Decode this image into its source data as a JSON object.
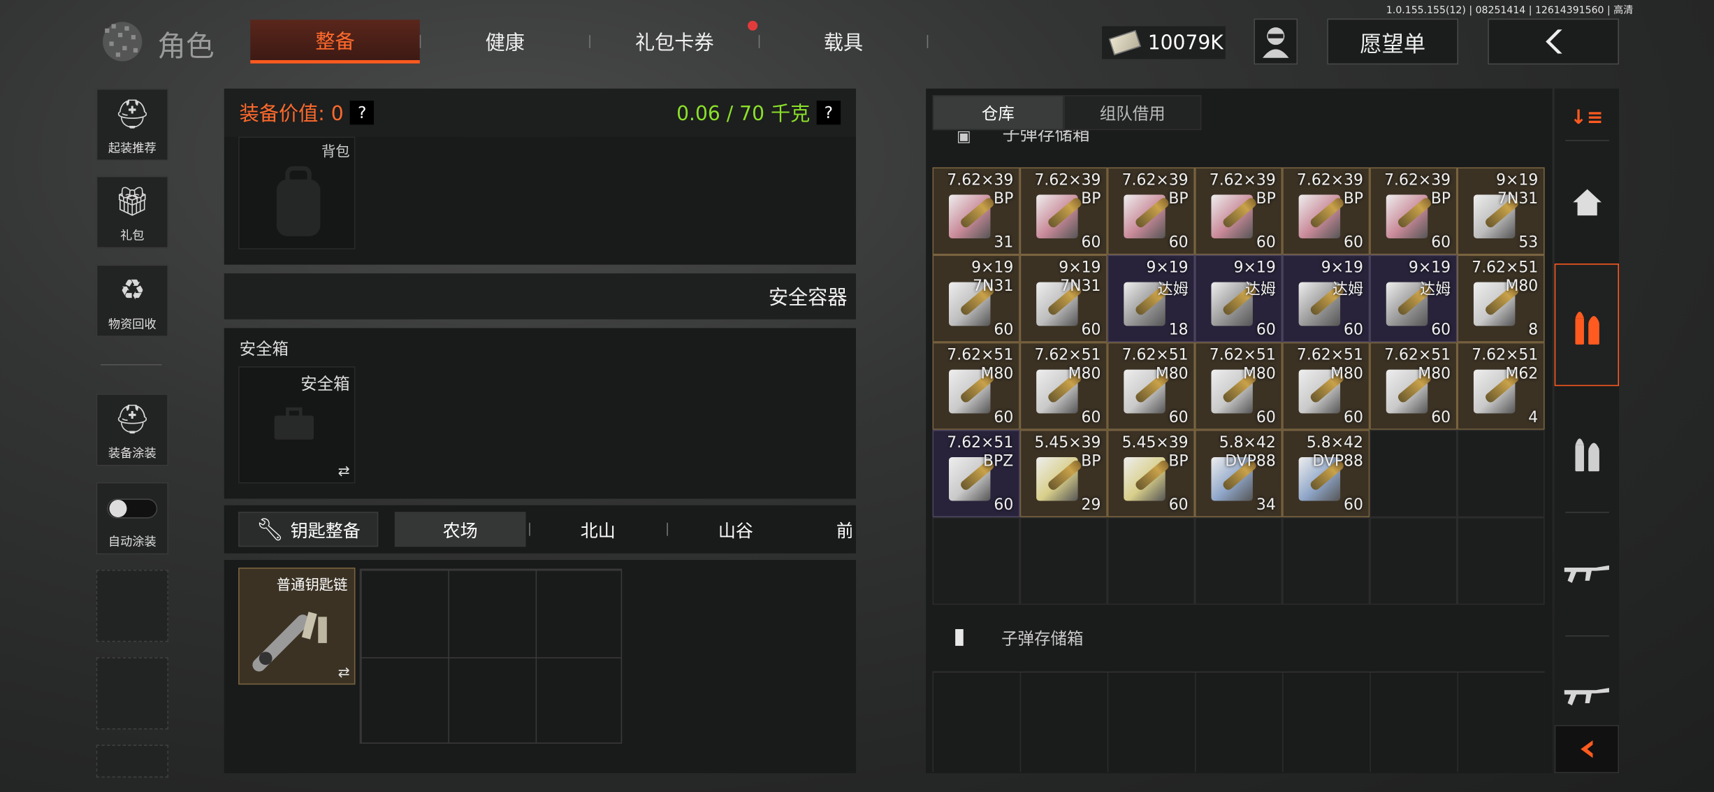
{
  "version": "1.0.155.155(12) | 08251414 | 12614391560 | 高清",
  "header": {
    "title": "角色",
    "tabs": [
      {
        "label": "整备",
        "active": true
      },
      {
        "label": "健康"
      },
      {
        "label": "礼包卡券",
        "badge": true
      },
      {
        "label": "载具"
      }
    ],
    "money": "10079K",
    "wishlist": "愿望单"
  },
  "sidebar": {
    "items": [
      {
        "label": "起装推荐",
        "icon": "helmet-icon"
      },
      {
        "label": "礼包",
        "icon": "gift-icon"
      },
      {
        "label": "物资回收",
        "icon": "recycle-icon"
      },
      {
        "label": "装备涂装",
        "icon": "paint-icon"
      },
      {
        "label": "自动涂装",
        "icon": "toggle-icon"
      }
    ]
  },
  "equipment": {
    "value_label": "装备价值: 0",
    "weight": "0.06 / 70 千克",
    "backpack_label": "背包",
    "secure_header": "安全容器",
    "secure_box_label": "安全箱",
    "secure_slot_label": "安全箱",
    "swap_icon": "⇄"
  },
  "keys": {
    "button": "钥匙整备",
    "tabs": [
      "农场",
      "北山",
      "山谷",
      "前"
    ],
    "keychain_label": "普通钥匙链"
  },
  "storage": {
    "tabs": [
      "仓库",
      "组队借用"
    ],
    "section_cut": "子弹存储箱",
    "section2": "子弹存储箱",
    "items": [
      {
        "cal": "7.62×39",
        "sub": "BP",
        "count": "31",
        "tone": "y",
        "box": "#c98a99"
      },
      {
        "cal": "7.62×39",
        "sub": "BP",
        "count": "60",
        "tone": "y",
        "box": "#c98a99"
      },
      {
        "cal": "7.62×39",
        "sub": "BP",
        "count": "60",
        "tone": "y",
        "box": "#c98a99"
      },
      {
        "cal": "7.62×39",
        "sub": "BP",
        "count": "60",
        "tone": "y",
        "box": "#c98a99"
      },
      {
        "cal": "7.62×39",
        "sub": "BP",
        "count": "60",
        "tone": "y",
        "box": "#c98a99"
      },
      {
        "cal": "7.62×39",
        "sub": "BP",
        "count": "60",
        "tone": "y",
        "box": "#c98a99"
      },
      {
        "cal": "9×19",
        "sub": "7N31",
        "count": "53",
        "tone": "y",
        "box": "#bdbdbd"
      },
      {
        "cal": "9×19",
        "sub": "7N31",
        "count": "60",
        "tone": "y",
        "box": "#bdbdbd"
      },
      {
        "cal": "9×19",
        "sub": "7N31",
        "count": "60",
        "tone": "y",
        "box": "#bdbdbd"
      },
      {
        "cal": "9×19",
        "sub": "达姆",
        "count": "18",
        "tone": "p",
        "box": "#9a9a9a"
      },
      {
        "cal": "9×19",
        "sub": "达姆",
        "count": "60",
        "tone": "p",
        "box": "#9a9a9a"
      },
      {
        "cal": "9×19",
        "sub": "达姆",
        "count": "60",
        "tone": "p",
        "box": "#9a9a9a"
      },
      {
        "cal": "9×19",
        "sub": "达姆",
        "count": "60",
        "tone": "p",
        "box": "#9a9a9a"
      },
      {
        "cal": "7.62×51",
        "sub": "M80",
        "count": "8",
        "tone": "y",
        "box": "#c9c9c9"
      },
      {
        "cal": "7.62×51",
        "sub": "M80",
        "count": "60",
        "tone": "y",
        "box": "#c9c9c9"
      },
      {
        "cal": "7.62×51",
        "sub": "M80",
        "count": "60",
        "tone": "y",
        "box": "#c9c9c9"
      },
      {
        "cal": "7.62×51",
        "sub": "M80",
        "count": "60",
        "tone": "y",
        "box": "#c9c9c9"
      },
      {
        "cal": "7.62×51",
        "sub": "M80",
        "count": "60",
        "tone": "y",
        "box": "#c9c9c9"
      },
      {
        "cal": "7.62×51",
        "sub": "M80",
        "count": "60",
        "tone": "y",
        "box": "#c9c9c9"
      },
      {
        "cal": "7.62×51",
        "sub": "M80",
        "count": "60",
        "tone": "y",
        "box": "#c9c9c9"
      },
      {
        "cal": "7.62×51",
        "sub": "M62",
        "count": "4",
        "tone": "y",
        "box": "#c9c9c9"
      },
      {
        "cal": "7.62×51",
        "sub": "BPZ",
        "count": "60",
        "tone": "p",
        "box": "#c9c9c9"
      },
      {
        "cal": "5.45×39",
        "sub": "BP",
        "count": "29",
        "tone": "y",
        "box": "#d8cf8a"
      },
      {
        "cal": "5.45×39",
        "sub": "BP",
        "count": "60",
        "tone": "y",
        "box": "#d8cf8a"
      },
      {
        "cal": "5.8×42",
        "sub": "DVP88",
        "count": "34",
        "tone": "y",
        "box": "#8fa6c9"
      },
      {
        "cal": "5.8×42",
        "sub": "DVP88",
        "count": "60",
        "tone": "y",
        "box": "#8fa6c9"
      }
    ]
  },
  "colors": {
    "accent": "#ff5a1f",
    "weight_green": "#8ae02a",
    "value_orange": "#ff6a2c",
    "cell_gold": "#7a6440",
    "cell_purple": "#4d4560"
  }
}
